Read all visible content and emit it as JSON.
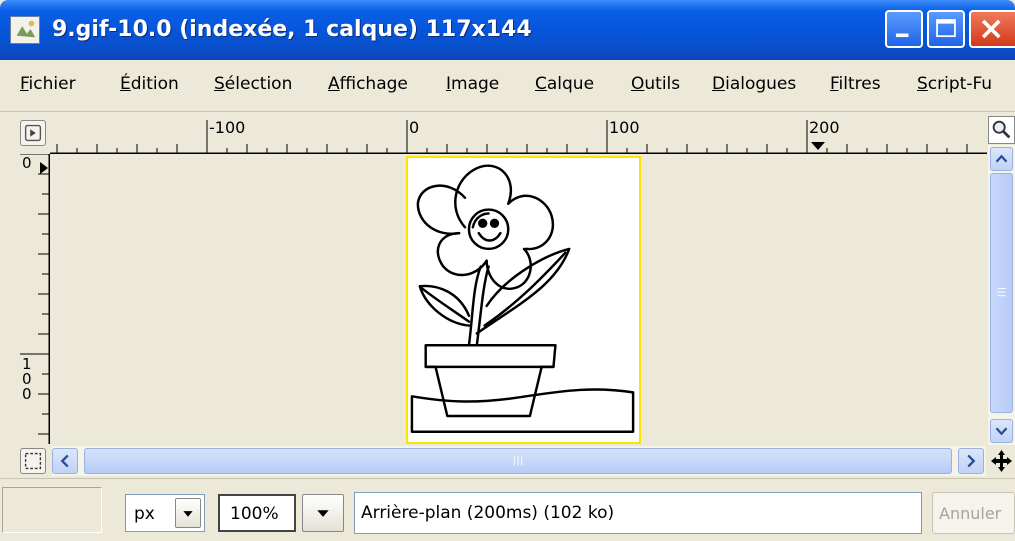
{
  "window": {
    "title": "9.gif-10.0 (indexée, 1 calque) 117x144"
  },
  "menu": {
    "items": [
      "Fichier",
      "Édition",
      "Sélection",
      "Affichage",
      "Image",
      "Calque",
      "Outils",
      "Dialogues",
      "Filtres",
      "Script-Fu"
    ]
  },
  "rulers": {
    "horizontal_labels": [
      "-100",
      "0",
      "100",
      "200"
    ],
    "vertical_labels": [
      "0",
      "1",
      "0",
      "0"
    ]
  },
  "statusbar": {
    "unit": "px",
    "zoom": "100%",
    "message": "Arrière-plan (200ms) (102 ko)",
    "cancel_label": "Annuler"
  },
  "colors": {
    "titlebar": "#0654d8",
    "selection_border": "#ffe400",
    "chrome": "#ece9d8"
  }
}
